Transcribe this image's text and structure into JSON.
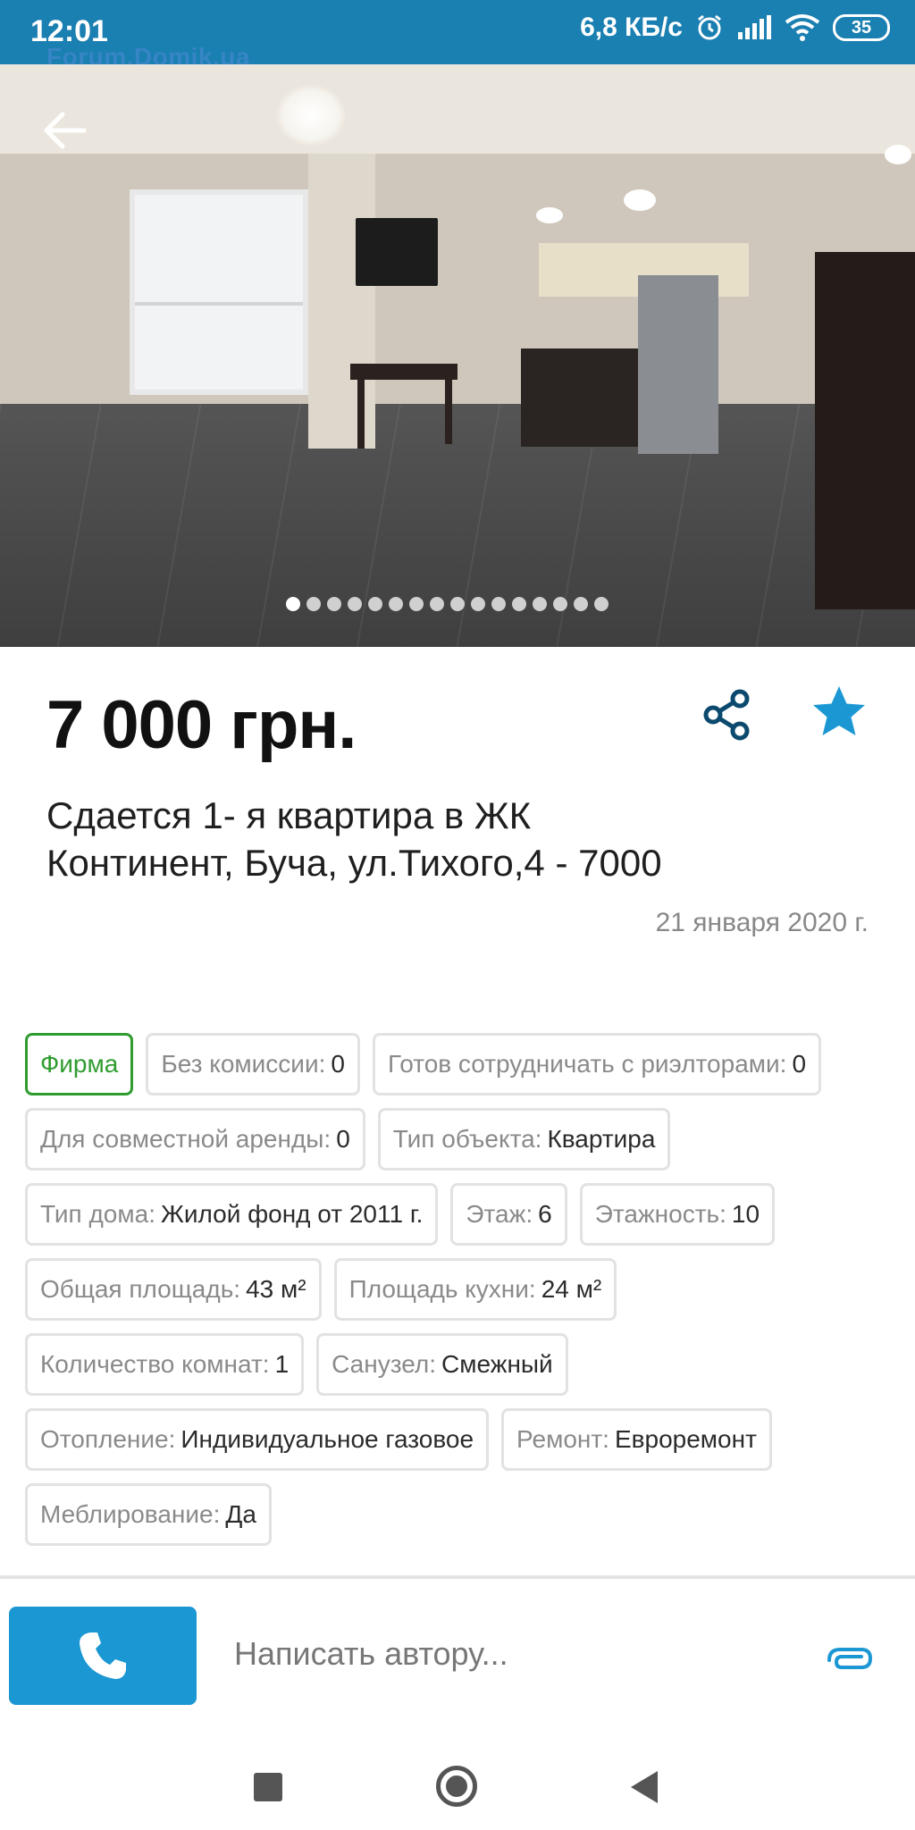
{
  "status_bar": {
    "time": "12:01",
    "speed": "6,8 КБ/с",
    "battery": "35",
    "watermark": "Forum.Domik.ua"
  },
  "gallery": {
    "photo_count": 16,
    "active_index": 0
  },
  "listing": {
    "price": "7 000 грн.",
    "title": "Сдается 1- я квартира в ЖК Континент, Буча, ул.Тихого,4 - 7000",
    "date": "21 января 2020 г."
  },
  "params": [
    {
      "key": "Фирма",
      "value": ""
    },
    {
      "key": "Без комиссии:",
      "value": "0"
    },
    {
      "key": "Готов сотрудничать с риэлторами:",
      "value": "0"
    },
    {
      "key": "Для совместной аренды:",
      "value": "0"
    },
    {
      "key": "Тип объекта:",
      "value": "Квартира"
    },
    {
      "key": "Тип дома:",
      "value": "Жилой фонд от 2011 г."
    },
    {
      "key": "Этаж:",
      "value": "6"
    },
    {
      "key": "Этажность:",
      "value": "10"
    },
    {
      "key": "Общая площадь:",
      "value": "43 м²"
    },
    {
      "key": "Площадь кухни:",
      "value": "24 м²"
    },
    {
      "key": "Количество комнат:",
      "value": "1"
    },
    {
      "key": "Санузел:",
      "value": "Смежный"
    },
    {
      "key": "Отопление:",
      "value": "Индивидуальное газовое"
    },
    {
      "key": "Ремонт:",
      "value": "Евроремонт"
    },
    {
      "key": "Меблирование:",
      "value": "Да"
    }
  ],
  "compose": {
    "placeholder": "Написать автору..."
  },
  "colors": {
    "status_bar": "#1a7fb1",
    "accent_blue": "#1b97d3",
    "share_icon": "#0b4a6e",
    "firm_green": "#2f9c2f"
  }
}
